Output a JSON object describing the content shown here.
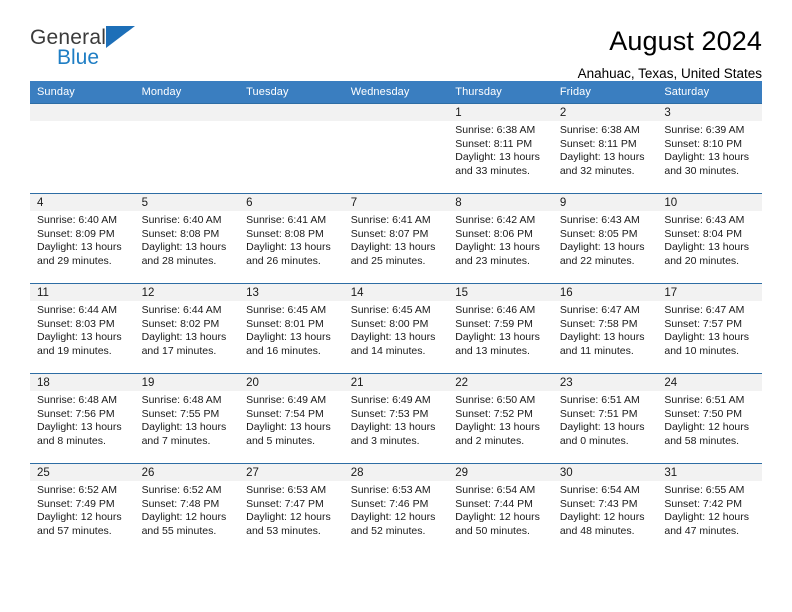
{
  "brand": {
    "line1": "General",
    "line2": "Blue",
    "triangle_icon": "brand-triangle-icon",
    "accent_color": "#1f7ec4"
  },
  "header": {
    "title": "August 2024",
    "location": "Anahuac, Texas, United States"
  },
  "theme": {
    "header_blue": "#3a7ec0",
    "row_border_blue": "#2e6da4",
    "daynum_band": "#f2f2f2"
  },
  "weekday_headers": [
    "Sunday",
    "Monday",
    "Tuesday",
    "Wednesday",
    "Thursday",
    "Friday",
    "Saturday"
  ],
  "weeks": [
    [
      {
        "day": "",
        "sunrise": "",
        "sunset": "",
        "daylight1": "",
        "daylight2": ""
      },
      {
        "day": "",
        "sunrise": "",
        "sunset": "",
        "daylight1": "",
        "daylight2": ""
      },
      {
        "day": "",
        "sunrise": "",
        "sunset": "",
        "daylight1": "",
        "daylight2": ""
      },
      {
        "day": "",
        "sunrise": "",
        "sunset": "",
        "daylight1": "",
        "daylight2": ""
      },
      {
        "day": "1",
        "sunrise": "Sunrise: 6:38 AM",
        "sunset": "Sunset: 8:11 PM",
        "daylight1": "Daylight: 13 hours",
        "daylight2": "and 33 minutes."
      },
      {
        "day": "2",
        "sunrise": "Sunrise: 6:38 AM",
        "sunset": "Sunset: 8:11 PM",
        "daylight1": "Daylight: 13 hours",
        "daylight2": "and 32 minutes."
      },
      {
        "day": "3",
        "sunrise": "Sunrise: 6:39 AM",
        "sunset": "Sunset: 8:10 PM",
        "daylight1": "Daylight: 13 hours",
        "daylight2": "and 30 minutes."
      }
    ],
    [
      {
        "day": "4",
        "sunrise": "Sunrise: 6:40 AM",
        "sunset": "Sunset: 8:09 PM",
        "daylight1": "Daylight: 13 hours",
        "daylight2": "and 29 minutes."
      },
      {
        "day": "5",
        "sunrise": "Sunrise: 6:40 AM",
        "sunset": "Sunset: 8:08 PM",
        "daylight1": "Daylight: 13 hours",
        "daylight2": "and 28 minutes."
      },
      {
        "day": "6",
        "sunrise": "Sunrise: 6:41 AM",
        "sunset": "Sunset: 8:08 PM",
        "daylight1": "Daylight: 13 hours",
        "daylight2": "and 26 minutes."
      },
      {
        "day": "7",
        "sunrise": "Sunrise: 6:41 AM",
        "sunset": "Sunset: 8:07 PM",
        "daylight1": "Daylight: 13 hours",
        "daylight2": "and 25 minutes."
      },
      {
        "day": "8",
        "sunrise": "Sunrise: 6:42 AM",
        "sunset": "Sunset: 8:06 PM",
        "daylight1": "Daylight: 13 hours",
        "daylight2": "and 23 minutes."
      },
      {
        "day": "9",
        "sunrise": "Sunrise: 6:43 AM",
        "sunset": "Sunset: 8:05 PM",
        "daylight1": "Daylight: 13 hours",
        "daylight2": "and 22 minutes."
      },
      {
        "day": "10",
        "sunrise": "Sunrise: 6:43 AM",
        "sunset": "Sunset: 8:04 PM",
        "daylight1": "Daylight: 13 hours",
        "daylight2": "and 20 minutes."
      }
    ],
    [
      {
        "day": "11",
        "sunrise": "Sunrise: 6:44 AM",
        "sunset": "Sunset: 8:03 PM",
        "daylight1": "Daylight: 13 hours",
        "daylight2": "and 19 minutes."
      },
      {
        "day": "12",
        "sunrise": "Sunrise: 6:44 AM",
        "sunset": "Sunset: 8:02 PM",
        "daylight1": "Daylight: 13 hours",
        "daylight2": "and 17 minutes."
      },
      {
        "day": "13",
        "sunrise": "Sunrise: 6:45 AM",
        "sunset": "Sunset: 8:01 PM",
        "daylight1": "Daylight: 13 hours",
        "daylight2": "and 16 minutes."
      },
      {
        "day": "14",
        "sunrise": "Sunrise: 6:45 AM",
        "sunset": "Sunset: 8:00 PM",
        "daylight1": "Daylight: 13 hours",
        "daylight2": "and 14 minutes."
      },
      {
        "day": "15",
        "sunrise": "Sunrise: 6:46 AM",
        "sunset": "Sunset: 7:59 PM",
        "daylight1": "Daylight: 13 hours",
        "daylight2": "and 13 minutes."
      },
      {
        "day": "16",
        "sunrise": "Sunrise: 6:47 AM",
        "sunset": "Sunset: 7:58 PM",
        "daylight1": "Daylight: 13 hours",
        "daylight2": "and 11 minutes."
      },
      {
        "day": "17",
        "sunrise": "Sunrise: 6:47 AM",
        "sunset": "Sunset: 7:57 PM",
        "daylight1": "Daylight: 13 hours",
        "daylight2": "and 10 minutes."
      }
    ],
    [
      {
        "day": "18",
        "sunrise": "Sunrise: 6:48 AM",
        "sunset": "Sunset: 7:56 PM",
        "daylight1": "Daylight: 13 hours",
        "daylight2": "and 8 minutes."
      },
      {
        "day": "19",
        "sunrise": "Sunrise: 6:48 AM",
        "sunset": "Sunset: 7:55 PM",
        "daylight1": "Daylight: 13 hours",
        "daylight2": "and 7 minutes."
      },
      {
        "day": "20",
        "sunrise": "Sunrise: 6:49 AM",
        "sunset": "Sunset: 7:54 PM",
        "daylight1": "Daylight: 13 hours",
        "daylight2": "and 5 minutes."
      },
      {
        "day": "21",
        "sunrise": "Sunrise: 6:49 AM",
        "sunset": "Sunset: 7:53 PM",
        "daylight1": "Daylight: 13 hours",
        "daylight2": "and 3 minutes."
      },
      {
        "day": "22",
        "sunrise": "Sunrise: 6:50 AM",
        "sunset": "Sunset: 7:52 PM",
        "daylight1": "Daylight: 13 hours",
        "daylight2": "and 2 minutes."
      },
      {
        "day": "23",
        "sunrise": "Sunrise: 6:51 AM",
        "sunset": "Sunset: 7:51 PM",
        "daylight1": "Daylight: 13 hours",
        "daylight2": "and 0 minutes."
      },
      {
        "day": "24",
        "sunrise": "Sunrise: 6:51 AM",
        "sunset": "Sunset: 7:50 PM",
        "daylight1": "Daylight: 12 hours",
        "daylight2": "and 58 minutes."
      }
    ],
    [
      {
        "day": "25",
        "sunrise": "Sunrise: 6:52 AM",
        "sunset": "Sunset: 7:49 PM",
        "daylight1": "Daylight: 12 hours",
        "daylight2": "and 57 minutes."
      },
      {
        "day": "26",
        "sunrise": "Sunrise: 6:52 AM",
        "sunset": "Sunset: 7:48 PM",
        "daylight1": "Daylight: 12 hours",
        "daylight2": "and 55 minutes."
      },
      {
        "day": "27",
        "sunrise": "Sunrise: 6:53 AM",
        "sunset": "Sunset: 7:47 PM",
        "daylight1": "Daylight: 12 hours",
        "daylight2": "and 53 minutes."
      },
      {
        "day": "28",
        "sunrise": "Sunrise: 6:53 AM",
        "sunset": "Sunset: 7:46 PM",
        "daylight1": "Daylight: 12 hours",
        "daylight2": "and 52 minutes."
      },
      {
        "day": "29",
        "sunrise": "Sunrise: 6:54 AM",
        "sunset": "Sunset: 7:44 PM",
        "daylight1": "Daylight: 12 hours",
        "daylight2": "and 50 minutes."
      },
      {
        "day": "30",
        "sunrise": "Sunrise: 6:54 AM",
        "sunset": "Sunset: 7:43 PM",
        "daylight1": "Daylight: 12 hours",
        "daylight2": "and 48 minutes."
      },
      {
        "day": "31",
        "sunrise": "Sunrise: 6:55 AM",
        "sunset": "Sunset: 7:42 PM",
        "daylight1": "Daylight: 12 hours",
        "daylight2": "and 47 minutes."
      }
    ]
  ]
}
